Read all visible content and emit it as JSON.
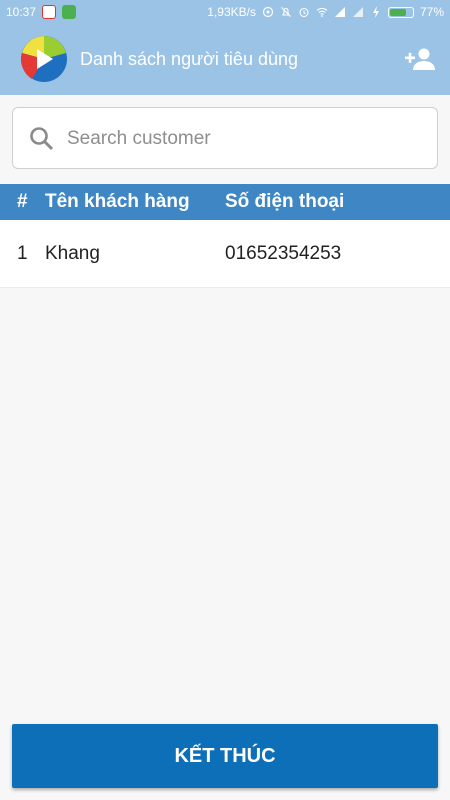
{
  "status_bar": {
    "time": "10:37",
    "network_speed": "1,93KB/s",
    "battery": "77%",
    "battery_level": 0.77
  },
  "app_bar": {
    "title": "Danh sách người tiêu dùng",
    "logo_icon": "app-logo-icon",
    "action_icon": "add-person-icon"
  },
  "search": {
    "placeholder": "Search customer",
    "value": ""
  },
  "table": {
    "headers": [
      "#",
      "Tên khách hàng",
      "Số điện thoại"
    ],
    "rows": [
      {
        "index": "1",
        "name": "Khang",
        "phone": "01652354253"
      }
    ]
  },
  "footer": {
    "end_label": "KẾT THÚC"
  },
  "colors": {
    "app_bar": "#9bc3e6",
    "table_header": "#3f86c4",
    "primary_button": "#0d6fb8"
  }
}
